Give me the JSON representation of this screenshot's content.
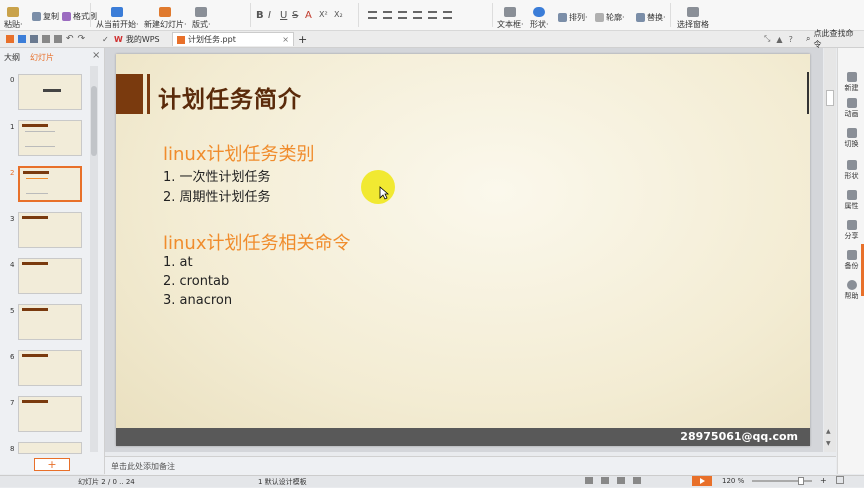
{
  "ribbon": {
    "paste": "粘贴·",
    "copy": "复制",
    "format_painter": "格式刷",
    "from_current": "从当前开始·",
    "new_slide": "新建幻灯片·",
    "layout": "版式·",
    "fmt_buttons": [
      "B",
      "I",
      "U",
      "S",
      "A",
      "X²",
      "X₂"
    ],
    "textbox": "文本框·",
    "shape": "形状·",
    "arrange": "排列·",
    "outline": "轮廓·",
    "replace": "替换·",
    "select_pane": "选择窗格"
  },
  "tabs": {
    "mywps": "我的WPS",
    "file": "计划任务.ppt",
    "add": "+",
    "search": "点此查找命令"
  },
  "left_panel": {
    "outline_tab": "大纲",
    "slides_tab": "幻灯片",
    "thumbs": [
      "0",
      "1",
      "2",
      "3",
      "4",
      "5",
      "6",
      "7",
      "8"
    ],
    "add_button": "+"
  },
  "slide": {
    "title": "计划任务简介",
    "section1": {
      "heading": "linux计划任务类别",
      "items": [
        "1. 一次性计划任务",
        "2. 周期性计划任务"
      ]
    },
    "section2": {
      "heading": "linux计划任务相关命令",
      "items": [
        "1. at",
        "2. crontab",
        "3. anacron"
      ]
    },
    "footer": "28975061@qq.com"
  },
  "right_bar": [
    "新建",
    "动画",
    "切换",
    "形状",
    "属性",
    "分享",
    "备份",
    "帮助"
  ],
  "notes_placeholder": "单击此处添加备注",
  "status": {
    "slide_info": "幻灯片 2 / 0 .. 24",
    "template": "1  默认设计模板",
    "zoom": "120 %"
  },
  "colors": {
    "accent_orange": "#f08c2c",
    "title_brown": "#5a2a0a",
    "footer_bar": "#595959",
    "title_block": "#7a3a0e"
  }
}
